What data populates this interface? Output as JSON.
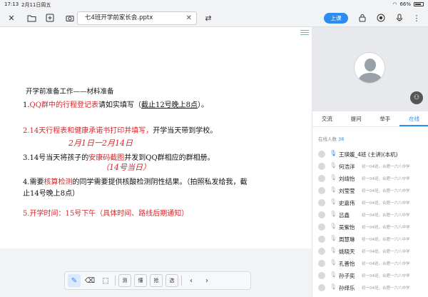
{
  "status": {
    "time": "17:13",
    "date": "2月11日周五",
    "battery": "66%"
  },
  "toolbar": {
    "doc_title": "七4班开学前家长会.pptx",
    "class_button": "上课"
  },
  "slide": {
    "heading": "开学前准备工作——材料准备",
    "item1_prefix": "1.",
    "item1_red": "QQ群中的行程登记表",
    "item1_black": "请如实填写（",
    "item1_ul": "截止12号晚上8点",
    "item1_end": "）。",
    "item2_red": "2.14天行程表和健康承诺书打印并填写，",
    "item2_black": "开学当天带到学校。",
    "hw1": "2月1日一2月14日",
    "item3_prefix": "3.14号当天将孩子的",
    "item3_red": "安康码截图",
    "item3_black": "并发到QQ群相应的群相册。",
    "hw2": "（14号当日）",
    "item4_prefix": "4.需要",
    "item4_red": "核算检测",
    "item4_black": "的同学需要提供核酸检测阴性结果。（拍照私发给我，截",
    "item4_line2": "止14号晚上8点）",
    "item5_red": "5.开学时间：15号下午（具体时间、路线后期通知）"
  },
  "bottom_tools": {
    "b1": "测",
    "b2": "懂",
    "b3": "抢",
    "b4": "选"
  },
  "panel": {
    "tabs": [
      "交流",
      "提问",
      "举手",
      "在线"
    ],
    "online_label": "在线人数",
    "online_count": "38",
    "members": [
      {
        "name": "王瑛媛_4班 (主讲)(本机)",
        "school": ""
      },
      {
        "name": "何浩洋",
        "school": "初一04班，合肥一六八中学"
      },
      {
        "name": "刘靖怡",
        "school": "初一04班，合肥一六八中学"
      },
      {
        "name": "刘莹莹",
        "school": "初一04班，合肥一六八中学"
      },
      {
        "name": "史嘉伟",
        "school": "初一04班，合肥一六八中学"
      },
      {
        "name": "吕鑫",
        "school": "初一04班，合肥一六八中学"
      },
      {
        "name": "吴紫怡",
        "school": "初一04班，合肥一六八中学"
      },
      {
        "name": "周慧琳",
        "school": "初一04班，合肥一六八中学"
      },
      {
        "name": "姚晓天",
        "school": "初一04班，合肥一六八中学"
      },
      {
        "name": "孔善怡",
        "school": "初一04班，合肥一六八中学"
      },
      {
        "name": "孙子奕",
        "school": "初一04班，合肥一六八中学"
      },
      {
        "name": "孙绎乐",
        "school": "初一04班，合肥一六八中学"
      }
    ]
  }
}
